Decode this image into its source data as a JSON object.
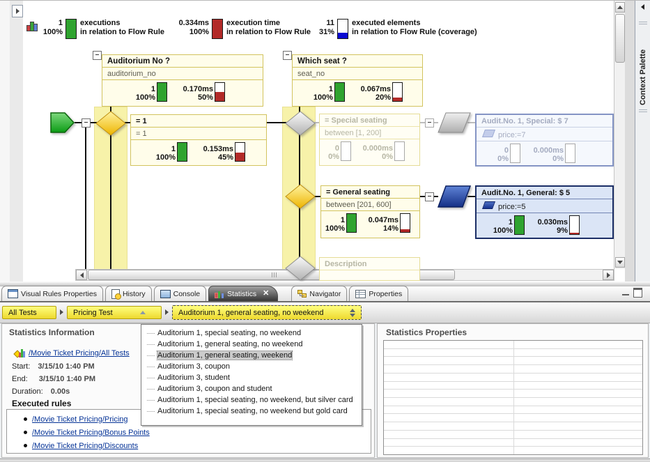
{
  "summary": {
    "executions": {
      "value": "1",
      "percent": "100%",
      "fill": 100,
      "line1": "executions",
      "line2": "in relation to Flow Rule"
    },
    "time": {
      "value": "0.334ms",
      "percent": "100%",
      "fill": 100,
      "line1": "execution time",
      "line2": "in relation to Flow Rule"
    },
    "coverage": {
      "value": "11",
      "percent": "31%",
      "fill": 31,
      "line1": "executed elements",
      "line2": "in relation to Flow Rule (coverage)"
    }
  },
  "diagram": {
    "auditorium": {
      "title": "Auditorium No ?",
      "detail": "auditorium_no",
      "count": "1",
      "count_pct": "100%",
      "count_fill": 100,
      "time": "0.170ms",
      "time_pct": "50%",
      "time_fill": 50
    },
    "which_seat": {
      "title": "Which seat ?",
      "detail": "seat_no",
      "count": "1",
      "count_pct": "100%",
      "count_fill": 100,
      "time": "0.067ms",
      "time_pct": "20%",
      "time_fill": 20
    },
    "eq_one": {
      "title": "= 1",
      "detail": "= 1",
      "count": "1",
      "count_pct": "100%",
      "count_fill": 100,
      "time": "0.153ms",
      "time_pct": "45%",
      "time_fill": 45
    },
    "special_seating": {
      "title": "= Special seating",
      "detail": "between [1, 200]",
      "count": "0",
      "count_pct": "0%",
      "count_fill": 0,
      "time": "0.000ms",
      "time_pct": "0%",
      "time_fill": 0
    },
    "general_seating": {
      "title": "= General seating",
      "detail": "between [201, 600]",
      "count": "1",
      "count_pct": "100%",
      "count_fill": 100,
      "time": "0.047ms",
      "time_pct": "14%",
      "time_fill": 14
    },
    "special_result": {
      "title": "Audit.No. 1, Special: $ 7",
      "detail": "price:=7",
      "count": "0",
      "count_pct": "0%",
      "count_fill": 0,
      "time": "0.000ms",
      "time_pct": "0%",
      "time_fill": 0
    },
    "general_result": {
      "title": "Audit.No. 1, General: $ 5",
      "detail": "price:=5",
      "count": "1",
      "count_pct": "100%",
      "count_fill": 100,
      "time": "0.030ms",
      "time_pct": "9%",
      "time_fill": 9
    },
    "description": {
      "title": "Description"
    }
  },
  "context_palette_label": "Context Palette",
  "tabs": [
    {
      "label": "Visual Rules Properties",
      "active": false
    },
    {
      "label": "History",
      "active": false
    },
    {
      "label": "Console",
      "active": false
    },
    {
      "label": "Statistics",
      "active": true,
      "closable": true
    },
    {
      "label": "Navigator",
      "active": false
    },
    {
      "label": "Properties",
      "active": false
    }
  ],
  "breadcrumb": {
    "all_tests": "All Tests",
    "pricing_test": "Pricing Test",
    "current_test": "Auditorium 1, general seating, no weekend"
  },
  "test_dropdown": {
    "items": [
      "Auditorium 1, special seating, no weekend",
      "Auditorium 1, general seating, no weekend",
      "Auditorium 1, general seating, weekend",
      "Auditorium 3, coupon",
      "Auditorium 3, student",
      "Auditorium 3, coupon and student",
      "Auditorium 1, special seating, no weekend, but silver card",
      "Auditorium 1, special seating, no weekend but gold card"
    ],
    "highlighted_index": 2
  },
  "statistics_information": {
    "title": "Statistics Information",
    "root_link": "/Movie Ticket Pricing/All Tests",
    "start_label": "Start:",
    "start_value": "3/15/10 1:40 PM",
    "end_label": "End:",
    "end_value": "3/15/10 1:40 PM",
    "duration_label": "Duration:",
    "duration_value": "0.00s",
    "executed_rules_label": "Executed rules",
    "executed_rules": [
      "/Movie Ticket Pricing/Pricing",
      "/Movie Ticket Pricing/Bonus Points",
      "/Movie Ticket Pricing/Discounts"
    ]
  },
  "statistics_properties": {
    "title": "Statistics Properties",
    "rows": 14
  },
  "colors": {
    "executed_green": "#2fa32f",
    "time_red": "#b22a28",
    "coverage_blue": "#0a0ad2",
    "node_yellow": "#fffdea",
    "lane_yellow": "#f7f2a9",
    "result_blue": "#dbe5f6",
    "accent_yellow": "#f2dd30"
  }
}
